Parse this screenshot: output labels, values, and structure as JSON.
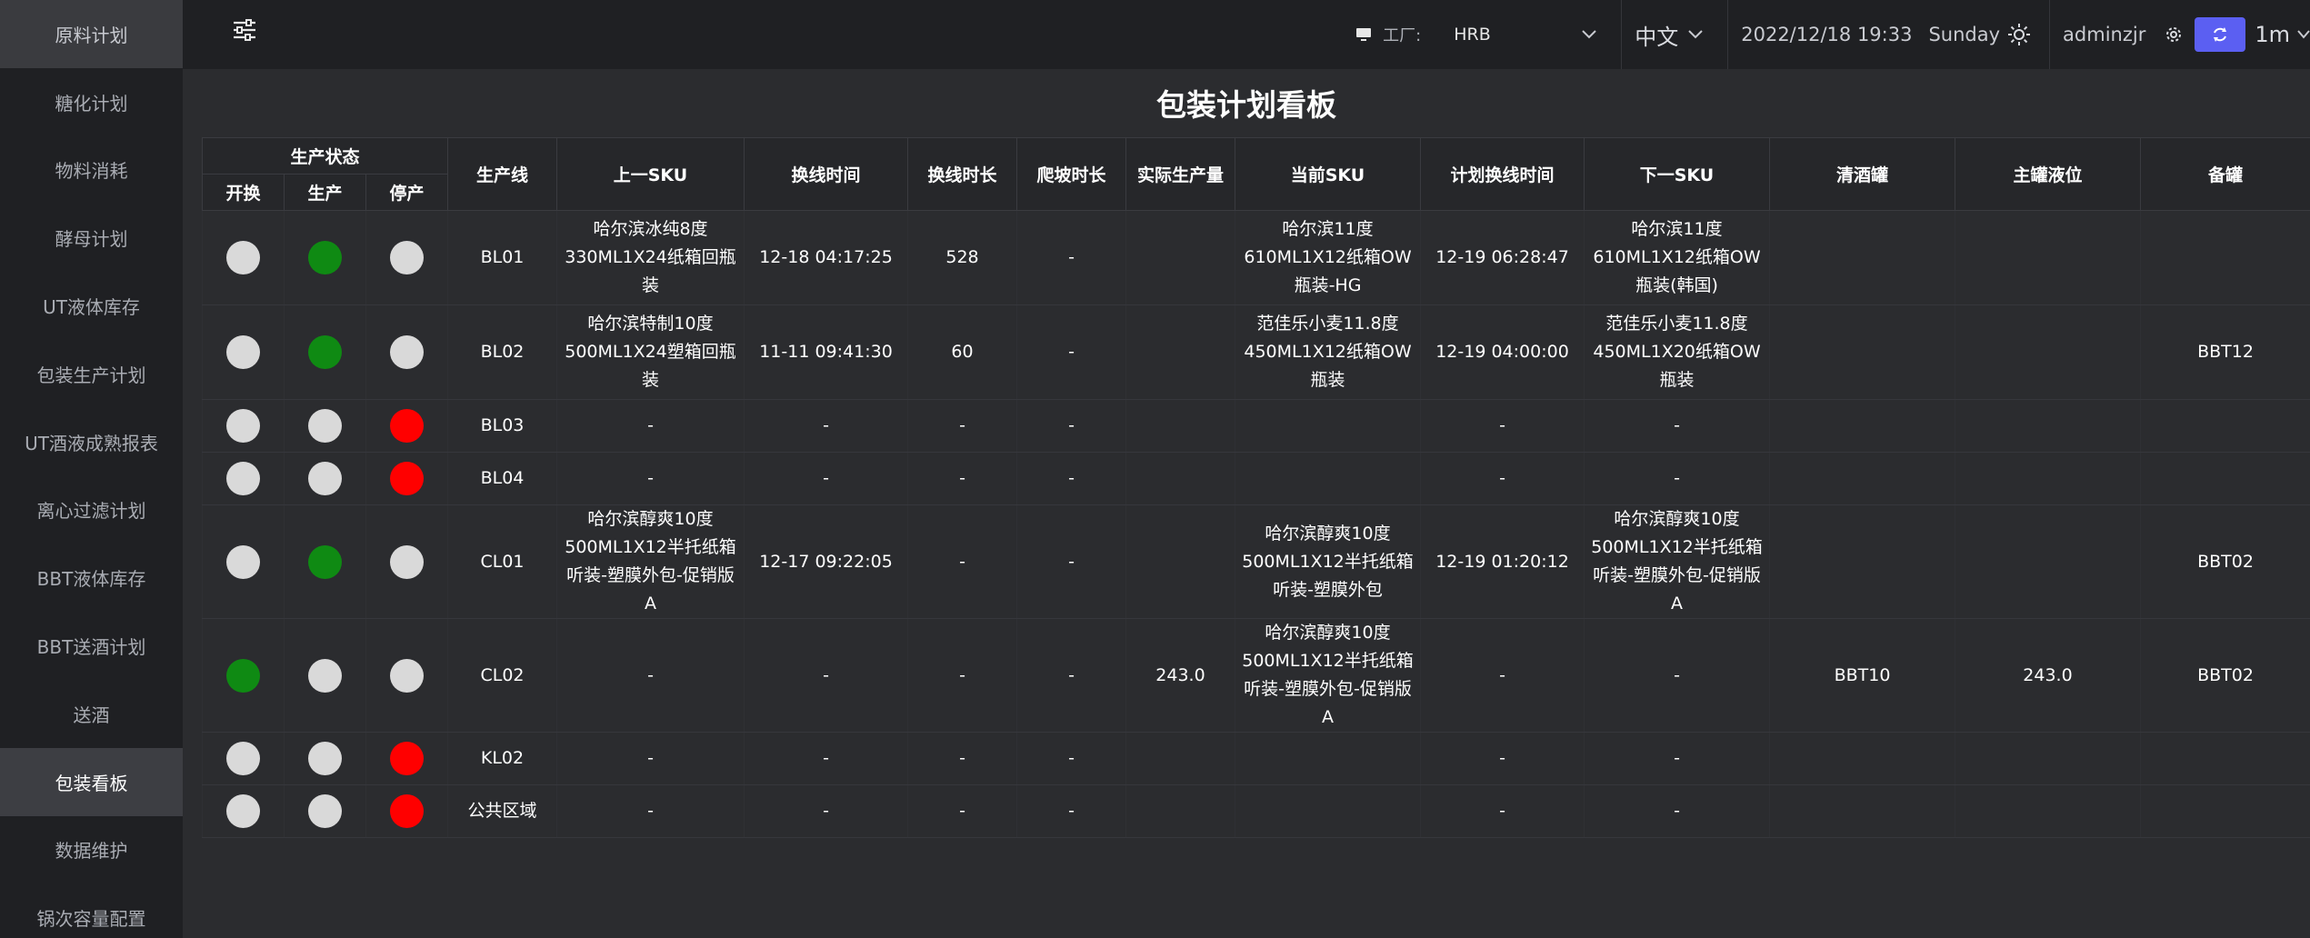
{
  "sidebar": {
    "items": [
      {
        "label": "原料计划"
      },
      {
        "label": "糖化计划"
      },
      {
        "label": "物料消耗"
      },
      {
        "label": "酵母计划"
      },
      {
        "label": "UT液体库存"
      },
      {
        "label": "包装生产计划"
      },
      {
        "label": "UT酒液成熟报表"
      },
      {
        "label": "离心过滤计划"
      },
      {
        "label": "BBT液体库存"
      },
      {
        "label": "BBT送酒计划"
      },
      {
        "label": "送酒"
      },
      {
        "label": "包装看板"
      },
      {
        "label": "数据维护"
      },
      {
        "label": "锅次容量配置"
      }
    ],
    "active": "包装看板"
  },
  "header": {
    "factory_label": "工厂:",
    "factory_value": "HRB",
    "language": "中文",
    "datetime": "2022/12/18 19:33",
    "weekday": "Sunday",
    "user": "adminzjr",
    "refresh_interval": "1m",
    "accent_color": "#5b5ff2"
  },
  "page": {
    "title": "包装计划看板"
  },
  "table": {
    "group_header": "生产状态",
    "status_headers": [
      "开换",
      "生产",
      "停产"
    ],
    "headers": {
      "line": "生产线",
      "prev_sku": "上一SKU",
      "change_time": "换线时间",
      "change_duration": "换线时长",
      "ramp_duration": "爬坡时长",
      "actual_output": "实际生产量",
      "current_sku": "当前SKU",
      "planned_change_time": "计划换线时间",
      "next_sku": "下一SKU",
      "clear_tank": "清酒罐",
      "main_tank_level": "主罐液位",
      "spare_tank": "备罐"
    },
    "status_colors": {
      "green": "#0f8a13",
      "red": "#ff0000",
      "gray": "#d9d9d9"
    },
    "rows": [
      {
        "status": [
          "gray",
          "green",
          "gray"
        ],
        "line": "BL01",
        "prev_sku": "哈尔滨冰纯8度330ML1X24纸箱回瓶装",
        "change_time": "12-18 04:17:25",
        "change_duration": "528",
        "ramp_duration": "-",
        "actual_output": "",
        "current_sku": "哈尔滨11度610ML1X12纸箱OW瓶装-HG",
        "planned_change_time": "12-19 06:28:47",
        "next_sku": "哈尔滨11度610ML1X12纸箱OW瓶装(韩国)",
        "clear_tank": "",
        "main_tank_level": "",
        "spare_tank": ""
      },
      {
        "status": [
          "gray",
          "green",
          "gray"
        ],
        "line": "BL02",
        "prev_sku": "哈尔滨特制10度500ML1X24塑箱回瓶装",
        "change_time": "11-11 09:41:30",
        "change_duration": "60",
        "ramp_duration": "-",
        "actual_output": "",
        "current_sku": "范佳乐小麦11.8度450ML1X12纸箱OW瓶装",
        "planned_change_time": "12-19 04:00:00",
        "next_sku": "范佳乐小麦11.8度450ML1X20纸箱OW瓶装",
        "clear_tank": "",
        "main_tank_level": "",
        "spare_tank": "BBT12"
      },
      {
        "status": [
          "gray",
          "gray",
          "red"
        ],
        "line": "BL03",
        "prev_sku": "-",
        "change_time": "-",
        "change_duration": "-",
        "ramp_duration": "-",
        "actual_output": "",
        "current_sku": "",
        "planned_change_time": "-",
        "next_sku": "-",
        "clear_tank": "",
        "main_tank_level": "",
        "spare_tank": ""
      },
      {
        "status": [
          "gray",
          "gray",
          "red"
        ],
        "line": "BL04",
        "prev_sku": "-",
        "change_time": "-",
        "change_duration": "-",
        "ramp_duration": "-",
        "actual_output": "",
        "current_sku": "",
        "planned_change_time": "-",
        "next_sku": "-",
        "clear_tank": "",
        "main_tank_level": "",
        "spare_tank": ""
      },
      {
        "status": [
          "gray",
          "green",
          "gray"
        ],
        "line": "CL01",
        "prev_sku": "哈尔滨醇爽10度500ML1X12半托纸箱听装-塑膜外包-促销版A",
        "change_time": "12-17 09:22:05",
        "change_duration": "-",
        "ramp_duration": "-",
        "actual_output": "",
        "current_sku": "哈尔滨醇爽10度500ML1X12半托纸箱听装-塑膜外包",
        "planned_change_time": "12-19 01:20:12",
        "next_sku": "哈尔滨醇爽10度500ML1X12半托纸箱听装-塑膜外包-促销版A",
        "clear_tank": "",
        "main_tank_level": "",
        "spare_tank": "BBT02"
      },
      {
        "status": [
          "green",
          "gray",
          "gray"
        ],
        "line": "CL02",
        "prev_sku": "-",
        "change_time": "-",
        "change_duration": "-",
        "ramp_duration": "-",
        "actual_output": "243.0",
        "current_sku": "哈尔滨醇爽10度500ML1X12半托纸箱听装-塑膜外包-促销版A",
        "planned_change_time": "-",
        "next_sku": "-",
        "clear_tank": "BBT10",
        "main_tank_level": "243.0",
        "spare_tank": "BBT02"
      },
      {
        "status": [
          "gray",
          "gray",
          "red"
        ],
        "line": "KL02",
        "prev_sku": "-",
        "change_time": "-",
        "change_duration": "-",
        "ramp_duration": "-",
        "actual_output": "",
        "current_sku": "",
        "planned_change_time": "-",
        "next_sku": "-",
        "clear_tank": "",
        "main_tank_level": "",
        "spare_tank": ""
      },
      {
        "status": [
          "gray",
          "gray",
          "red"
        ],
        "line": "公共区域",
        "prev_sku": "-",
        "change_time": "-",
        "change_duration": "-",
        "ramp_duration": "-",
        "actual_output": "",
        "current_sku": "",
        "planned_change_time": "-",
        "next_sku": "-",
        "clear_tank": "",
        "main_tank_level": "",
        "spare_tank": ""
      }
    ]
  }
}
